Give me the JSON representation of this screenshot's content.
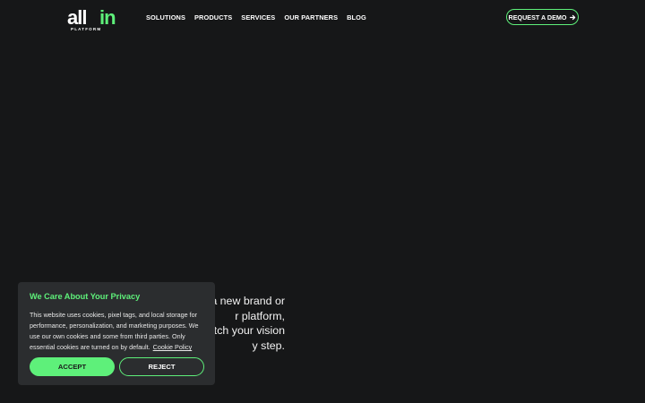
{
  "brand": {
    "logo_text": "all in",
    "logo_subtext": "PLATFORM",
    "accent_color": "#5ef07a"
  },
  "nav": {
    "items": [
      {
        "label": "SOLUTIONS"
      },
      {
        "label": "PRODUCTS"
      },
      {
        "label": "SERVICES"
      },
      {
        "label": "OUR PARTNERS"
      },
      {
        "label": "BLOG"
      }
    ],
    "cta_label": "REQUEST A DEMO",
    "cta_icon": "arrow-right-icon"
  },
  "hero": {
    "lines": [
      "a new brand or",
      "r platform,",
      "atch your vision",
      "y step."
    ]
  },
  "cookie": {
    "title": "We Care About Your Privacy",
    "body": "This website uses cookies, pixel tags, and local storage for performance, personalization, and marketing purposes. We use our own cookies and some from third parties. Only essential cookies are turned on by default.",
    "link_label": "Cookie Policy",
    "accept_label": "ACCEPT",
    "reject_label": "REJECT"
  }
}
